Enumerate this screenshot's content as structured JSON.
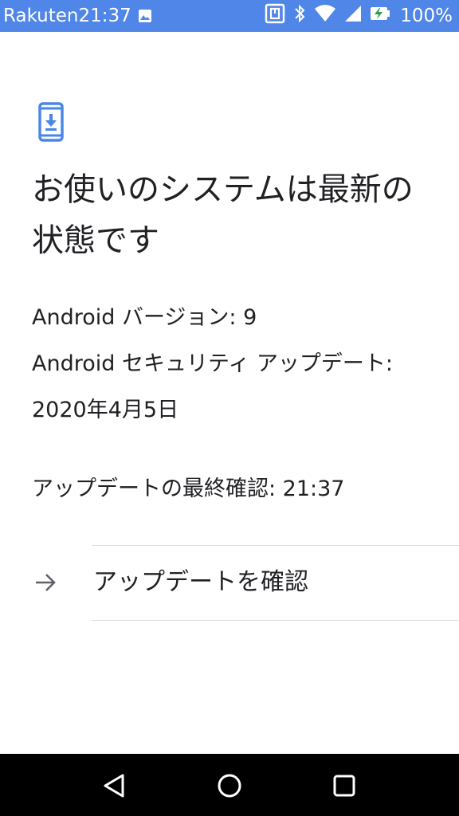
{
  "status_bar": {
    "carrier": "Rakuten",
    "time": "21:37",
    "battery": "100%",
    "icons": [
      "image-icon",
      "nfc-icon",
      "bluetooth-icon",
      "wifi-icon",
      "signal-icon",
      "battery-charging-icon"
    ],
    "background_color": "#4f86e7"
  },
  "page": {
    "icon": "phone-download-icon",
    "title": "お使いのシステムは最新の状態です",
    "android_version": "Android バージョン: 9",
    "security_update": "Android セキュリティ アップデート: 2020年4月5日",
    "last_check": "アップデートの最終確認: 21:37"
  },
  "action": {
    "icon": "arrow-right-icon",
    "label": "アップデートを確認"
  },
  "nav_bar": {
    "icons": [
      "back-icon",
      "home-icon",
      "recents-icon"
    ]
  },
  "colors": {
    "accent": "#4a86e8",
    "divider": "#dadce0"
  }
}
